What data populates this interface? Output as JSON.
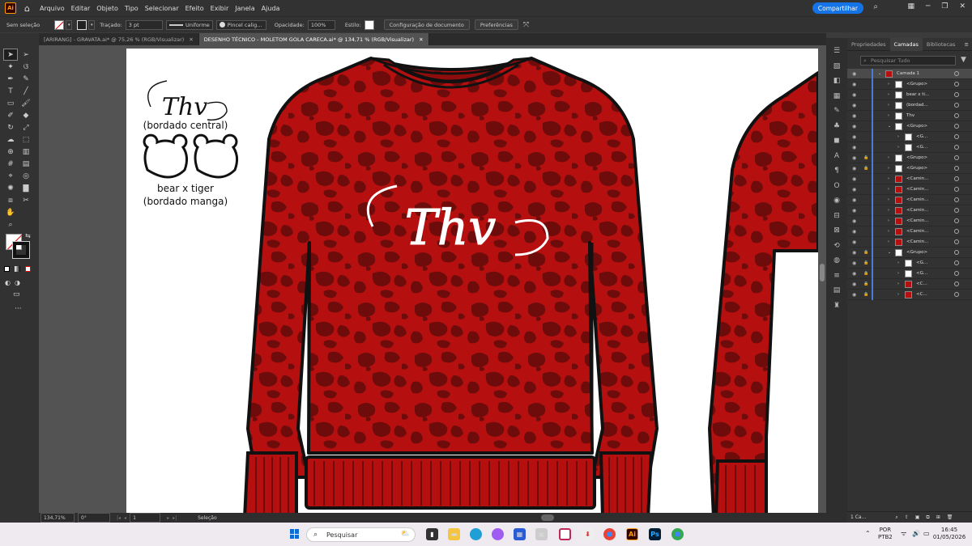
{
  "app": {
    "logo": "Ai",
    "menus": [
      "Arquivo",
      "Editar",
      "Objeto",
      "Tipo",
      "Selecionar",
      "Efeito",
      "Exibir",
      "Janela",
      "Ajuda"
    ],
    "share_label": "Compartilhar"
  },
  "control_bar": {
    "selection_label": "Sem seleção",
    "stroke_label": "Traçado:",
    "stroke_weight": "3 pt",
    "profile": "Uniforme",
    "brush": "Pincel calig...",
    "opacity_label": "Opacidade:",
    "opacity_value": "100%",
    "style_label": "Estilo:",
    "doc_setup_label": "Configuração de documento",
    "prefs_label": "Preferências"
  },
  "tabs": [
    {
      "label": "[ARIRANG] - GRAVATA.ai* @ 75,26 % (RGB/Visualizar)",
      "active": false
    },
    {
      "label": "DESENHO TÉCNICO - MOLETOM GOLA CARECA.ai* @ 134,71 % (RGB/Visualizar)",
      "active": true
    }
  ],
  "artboard": {
    "logo_script": "Thv",
    "note1": "(bordado central)",
    "note2_line1": "bear x tiger",
    "note2_line2": "(bordado manga)",
    "colors": {
      "base": "#b50f0f",
      "spot": "#6e0b0b",
      "outline": "#111111",
      "script": "#ffffff"
    }
  },
  "status": {
    "zoom": "134,71%",
    "rotation": "0°",
    "page": "1",
    "tool_mode": "Seleção"
  },
  "layers_panel": {
    "tabs": [
      "Propriedades",
      "Camadas",
      "Bibliotecas"
    ],
    "active_tab": "Camadas",
    "search_placeholder": "Pesquisar Tudo",
    "layers": [
      {
        "name": "Camada 1",
        "indent": 0,
        "expanded": true,
        "selected": true,
        "lock": false
      },
      {
        "name": "<Grupo>",
        "indent": 1,
        "expanded": false,
        "selected": false,
        "lock": false
      },
      {
        "name": "bear x ti...",
        "indent": 1,
        "expanded": false,
        "selected": false,
        "lock": false
      },
      {
        "name": "(bordad...",
        "indent": 1,
        "expanded": false,
        "selected": false,
        "lock": false
      },
      {
        "name": "Thv",
        "indent": 1,
        "expanded": false,
        "selected": false,
        "lock": false
      },
      {
        "name": "<Grupo>",
        "indent": 1,
        "expanded": true,
        "selected": false,
        "lock": false
      },
      {
        "name": "<G...",
        "indent": 2,
        "expanded": false,
        "selected": false,
        "lock": false
      },
      {
        "name": "<G...",
        "indent": 2,
        "expanded": false,
        "selected": false,
        "lock": false
      },
      {
        "name": "<Grupo>",
        "indent": 1,
        "expanded": false,
        "selected": false,
        "lock": true
      },
      {
        "name": "<Grupo>",
        "indent": 1,
        "expanded": false,
        "selected": false,
        "lock": true
      },
      {
        "name": "<Camin...",
        "indent": 1,
        "expanded": false,
        "selected": false,
        "lock": false
      },
      {
        "name": "<Camin...",
        "indent": 1,
        "expanded": false,
        "selected": false,
        "lock": false
      },
      {
        "name": "<Camin...",
        "indent": 1,
        "expanded": false,
        "selected": false,
        "lock": false
      },
      {
        "name": "<Camin...",
        "indent": 1,
        "expanded": false,
        "selected": false,
        "lock": false
      },
      {
        "name": "<Camin...",
        "indent": 1,
        "expanded": false,
        "selected": false,
        "lock": false
      },
      {
        "name": "<Camin...",
        "indent": 1,
        "expanded": false,
        "selected": false,
        "lock": false
      },
      {
        "name": "<Camin...",
        "indent": 1,
        "expanded": false,
        "selected": false,
        "lock": false
      },
      {
        "name": "<Grupo>",
        "indent": 1,
        "expanded": true,
        "selected": false,
        "lock": true
      },
      {
        "name": "<G...",
        "indent": 2,
        "expanded": false,
        "selected": false,
        "lock": true
      },
      {
        "name": "<G...",
        "indent": 2,
        "expanded": false,
        "selected": false,
        "lock": true
      },
      {
        "name": "<C...",
        "indent": 2,
        "expanded": false,
        "selected": false,
        "lock": true
      },
      {
        "name": "<C...",
        "indent": 2,
        "expanded": false,
        "selected": false,
        "lock": true
      }
    ],
    "footer": "1 Ca..."
  },
  "taskbar": {
    "search_placeholder": "Pesquisar",
    "lang1": "POR",
    "lang2": "PTB2",
    "time": "16:45",
    "date": "01/05/2026"
  }
}
